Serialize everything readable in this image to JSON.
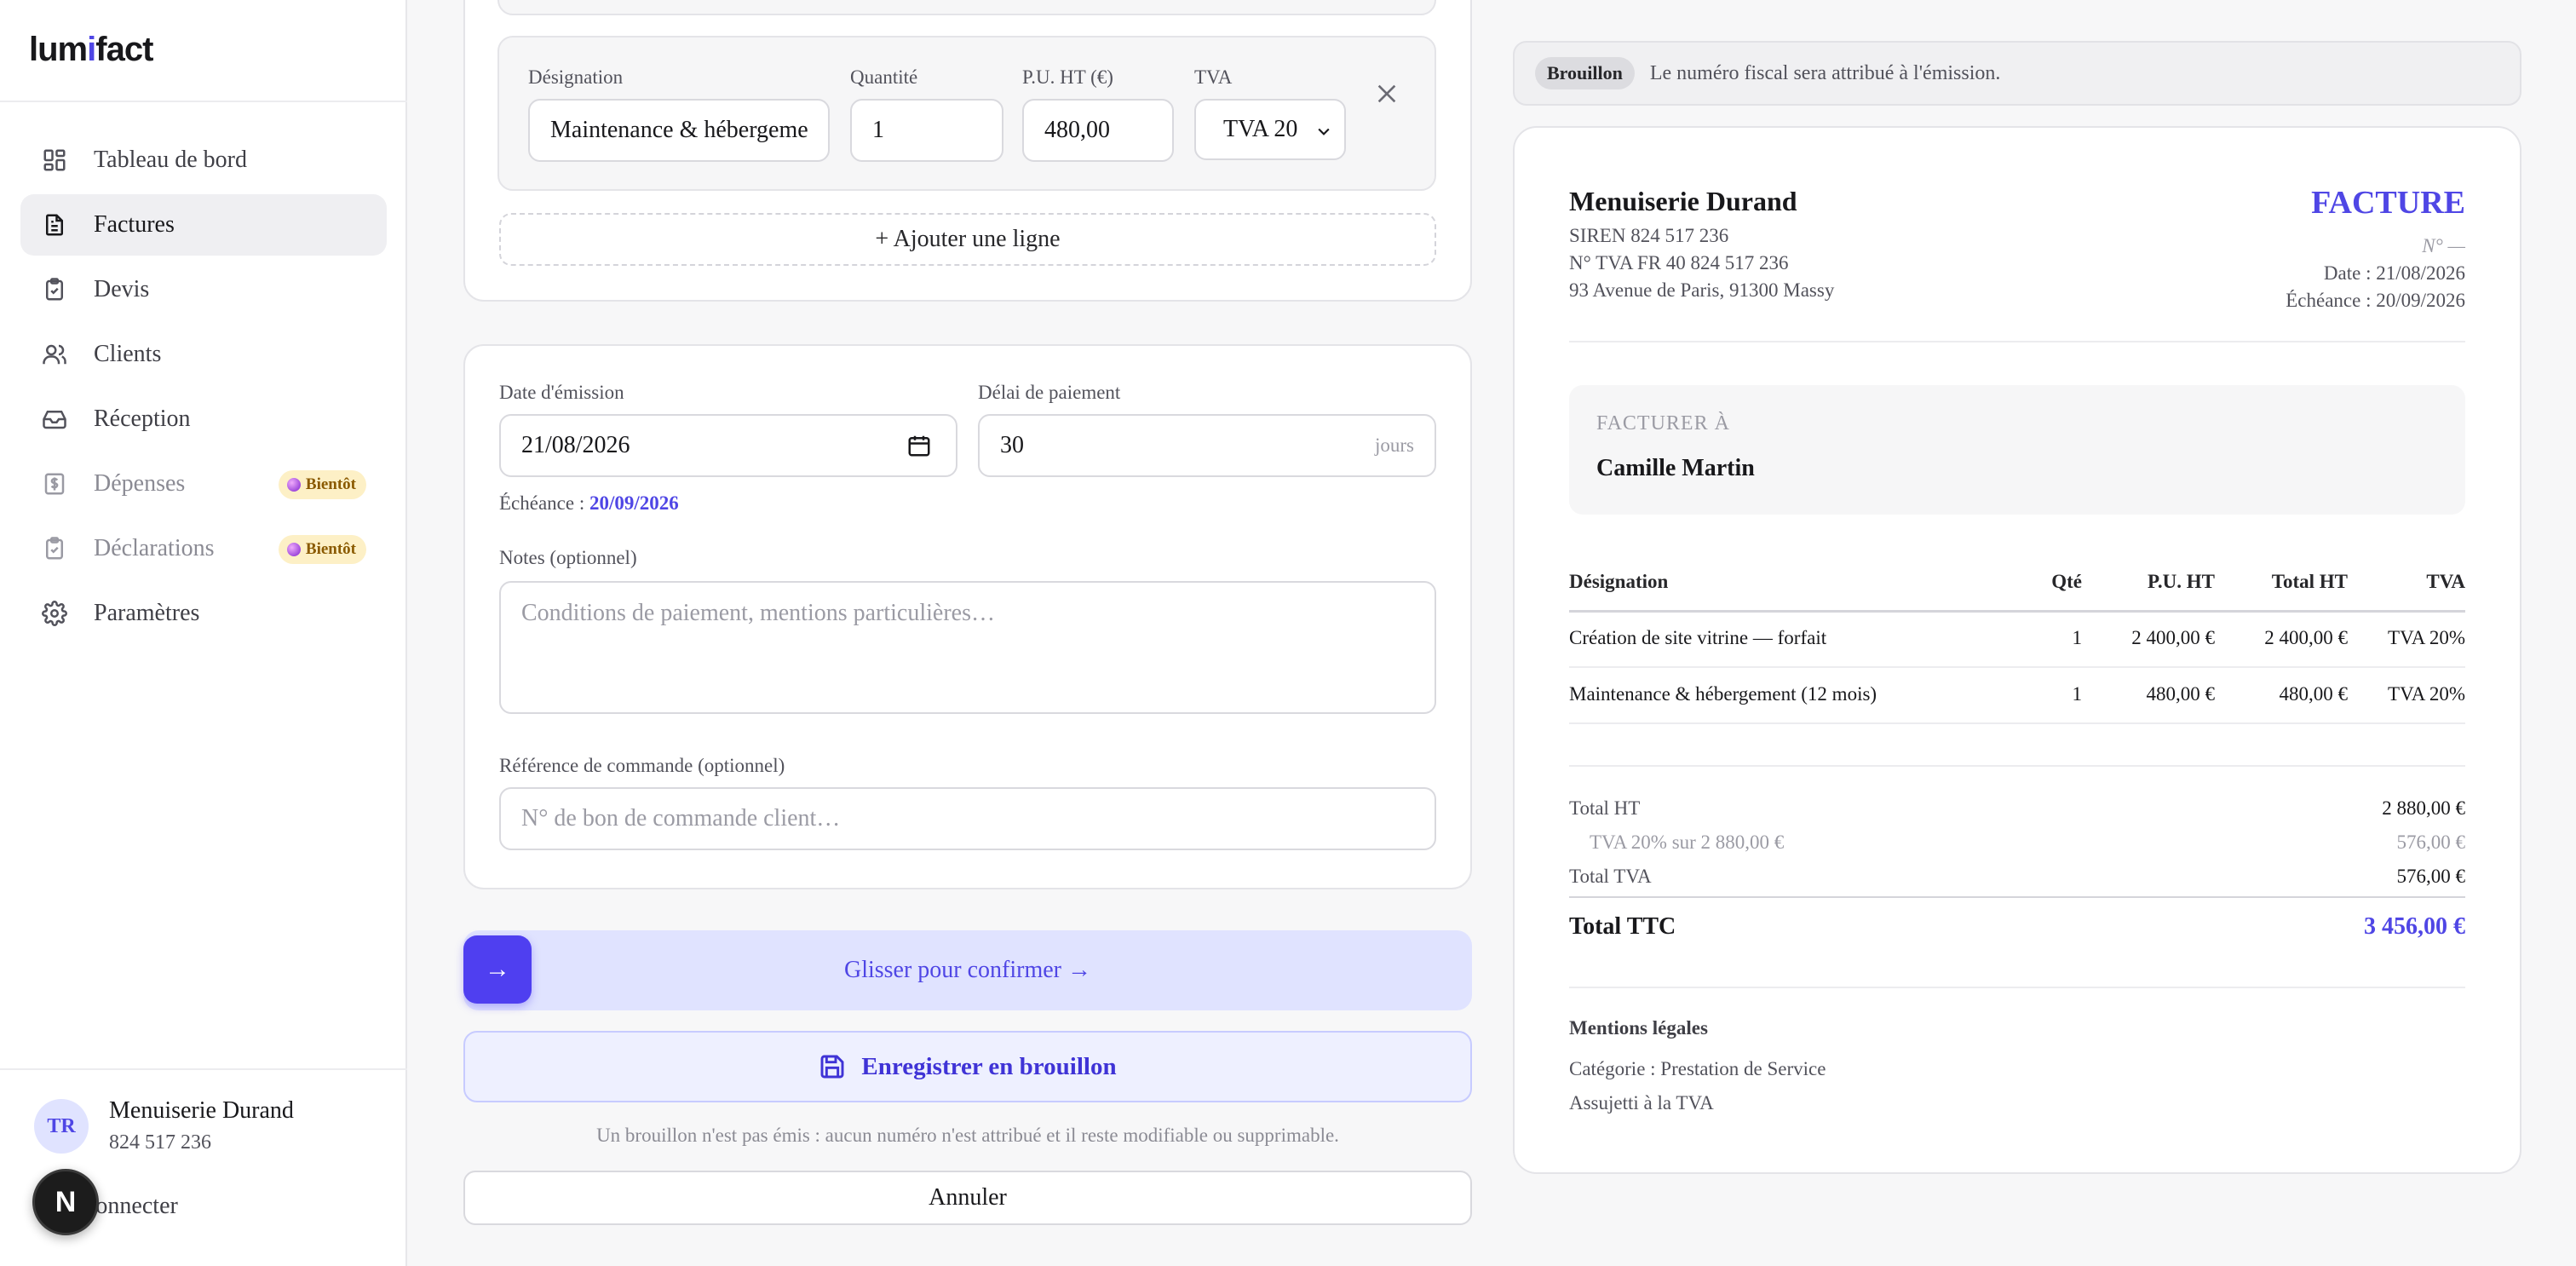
{
  "app": {
    "logo_pre": "lum",
    "logo_dot": "i",
    "logo_post": "fact"
  },
  "sidebar": {
    "items": [
      {
        "label": "Tableau de bord",
        "icon": "dashboard-icon"
      },
      {
        "label": "Factures",
        "icon": "invoice-icon",
        "active": true
      },
      {
        "label": "Devis",
        "icon": "quote-icon"
      },
      {
        "label": "Clients",
        "icon": "users-icon"
      },
      {
        "label": "Réception",
        "icon": "inbox-icon"
      },
      {
        "label": "Dépenses",
        "icon": "expense-icon",
        "badge": "Bientôt"
      },
      {
        "label": "Déclarations",
        "icon": "declaration-icon",
        "badge": "Bientôt"
      },
      {
        "label": "Paramètres",
        "icon": "gear-icon"
      }
    ],
    "user": {
      "initials": "TR",
      "name": "Menuiserie Durand",
      "siren": "824 517 236",
      "logout": "connecter"
    },
    "framework_badge": "N"
  },
  "line_item": {
    "designation_label": "Désignation",
    "designation_value": "Maintenance & hébergeme",
    "quantity_label": "Quantité",
    "quantity_value": "1",
    "unit_price_label": "P.U. HT (€)",
    "unit_price_value": "480,00",
    "vat_label": "TVA",
    "vat_value": "TVA 20"
  },
  "add_line_label": "+ Ajouter une ligne",
  "dates": {
    "issue_label": "Date d'émission",
    "issue_value": "21/08/2026",
    "delay_label": "Délai de paiement",
    "delay_value": "30",
    "delay_suffix": "jours",
    "due_prefix": "Échéance :",
    "due_value": "20/09/2026"
  },
  "notes": {
    "label": "Notes (optionnel)",
    "placeholder": "Conditions de paiement, mentions particulières…"
  },
  "order_ref": {
    "label": "Référence de commande (optionnel)",
    "placeholder": "N° de bon de commande client…"
  },
  "actions": {
    "slide_knob": "→",
    "slide_label": "Glisser pour confirmer →",
    "save_draft": "Enregistrer en brouillon",
    "draft_note": "Un brouillon n'est pas émis : aucun numéro n'est attribué et il reste modifiable ou supprimable.",
    "cancel": "Annuler"
  },
  "preview": {
    "status_pill": "Brouillon",
    "status_text": "Le numéro fiscal sera attribué à l'émission.",
    "company": "Menuiserie Durand",
    "siren": "SIREN 824 517 236",
    "vat_number": "N° TVA FR 40 824 517 236",
    "address": "93 Avenue de Paris, 91300 Massy",
    "doc_title": "FACTURE",
    "doc_number": "N° —",
    "date": "Date : 21/08/2026",
    "due": "Échéance : 20/09/2026",
    "bill_to_label": "FACTURER À",
    "bill_to_name": "Camille Martin",
    "table": {
      "headers": [
        "Désignation",
        "Qté",
        "P.U. HT",
        "Total HT",
        "TVA"
      ],
      "rows": [
        [
          "Création de site vitrine — forfait",
          "1",
          "2 400,00 €",
          "2 400,00 €",
          "TVA 20%"
        ],
        [
          "Maintenance & hébergement (12 mois)",
          "1",
          "480,00 €",
          "480,00 €",
          "TVA 20%"
        ]
      ]
    },
    "totals": {
      "ht_label": "Total HT",
      "ht_value": "2 880,00 €",
      "vat_detail_label": "TVA 20% sur 2 880,00 €",
      "vat_detail_value": "576,00 €",
      "vat_label": "Total TVA",
      "vat_value": "576,00 €",
      "ttc_label": "Total TTC",
      "ttc_value": "3 456,00 €"
    },
    "legal": {
      "title": "Mentions légales",
      "category": "Catégorie : Prestation de Service",
      "vat_status": "Assujetti à la TVA"
    }
  },
  "colors": {
    "accent": "#4f46e5",
    "badge_bg": "#fdf0c6",
    "slide_bg": "#e0e3ff"
  }
}
